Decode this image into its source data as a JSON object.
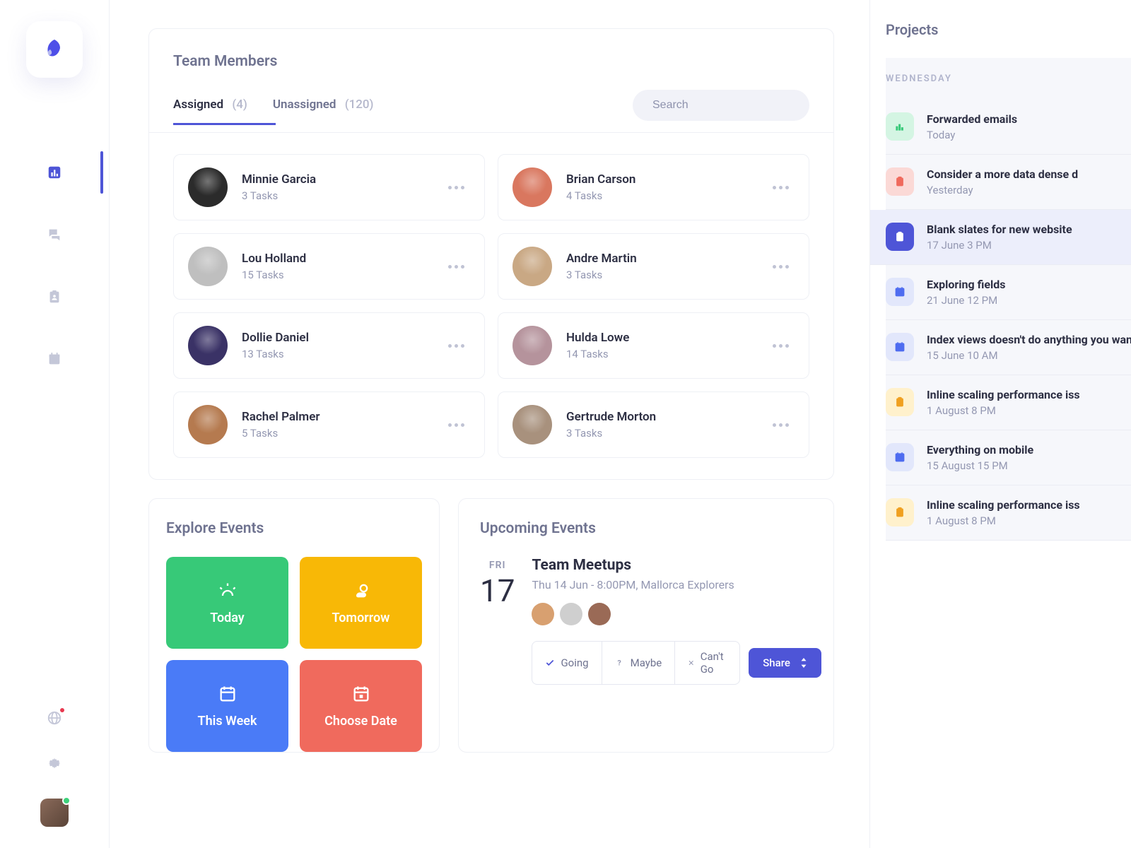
{
  "team": {
    "title": "Team Members",
    "tabs": [
      {
        "label": "Assigned",
        "count": "(4)"
      },
      {
        "label": "Unassigned",
        "count": "(120)"
      }
    ],
    "search_placeholder": "Search",
    "members": [
      {
        "name": "Minnie Garcia",
        "tasks": "3 Tasks",
        "avatar_bg": "#2b2b2b"
      },
      {
        "name": "Brian Carson",
        "tasks": "4 Tasks",
        "avatar_bg": "#d9775f"
      },
      {
        "name": "Lou Holland",
        "tasks": "15 Tasks",
        "avatar_bg": "#bfbfbf"
      },
      {
        "name": "Andre Martin",
        "tasks": "3 Tasks",
        "avatar_bg": "#c9a884"
      },
      {
        "name": "Dollie Daniel",
        "tasks": "13 Tasks",
        "avatar_bg": "#3a3266"
      },
      {
        "name": "Hulda Lowe",
        "tasks": "14 Tasks",
        "avatar_bg": "#b5939c"
      },
      {
        "name": "Rachel Palmer",
        "tasks": "5 Tasks",
        "avatar_bg": "#b57a4f"
      },
      {
        "name": "Gertrude Morton",
        "tasks": "3 Tasks",
        "avatar_bg": "#a8917d"
      }
    ]
  },
  "explore": {
    "title": "Explore Events",
    "tiles": [
      {
        "label": "Today"
      },
      {
        "label": "Tomorrow"
      },
      {
        "label": "This Week"
      },
      {
        "label": "Choose Date"
      }
    ]
  },
  "upcoming": {
    "title": "Upcoming Events",
    "day_name": "FRI",
    "day_num": "17",
    "event_title": "Team Meetups",
    "event_meta": "Thu 14 Jun - 8:00PM, Mallorca Explorers",
    "rsvp": {
      "going": "Going",
      "maybe": "Maybe",
      "cant": "Can't Go"
    },
    "share": "Share"
  },
  "projects": {
    "title": "Projects",
    "day": "WEDNESDAY",
    "items": [
      {
        "name": "Forwarded emails",
        "time": "Today",
        "icon": "chart",
        "color": "green"
      },
      {
        "name": "Consider a more data dense d",
        "time": "Yesterday",
        "icon": "clip",
        "color": "red"
      },
      {
        "name": "Blank slates for new website",
        "time": "17 June 3 PM",
        "icon": "clip",
        "color": "blue-solid",
        "selected": true
      },
      {
        "name": "Exploring fields",
        "time": "21 June 12 PM",
        "icon": "cal",
        "color": "blue"
      },
      {
        "name": "Index views doesn't do anything you want",
        "time": "15 June 10 AM",
        "icon": "cal",
        "color": "blue"
      },
      {
        "name": "Inline scaling performance iss",
        "time": "1 August 8 PM",
        "icon": "badge",
        "color": "yellow"
      },
      {
        "name": "Everything on mobile",
        "time": "15 August 15 PM",
        "icon": "cal",
        "color": "blue"
      },
      {
        "name": "Inline scaling performance iss",
        "time": "1 August 8 PM",
        "icon": "badge",
        "color": "yellow"
      }
    ]
  }
}
